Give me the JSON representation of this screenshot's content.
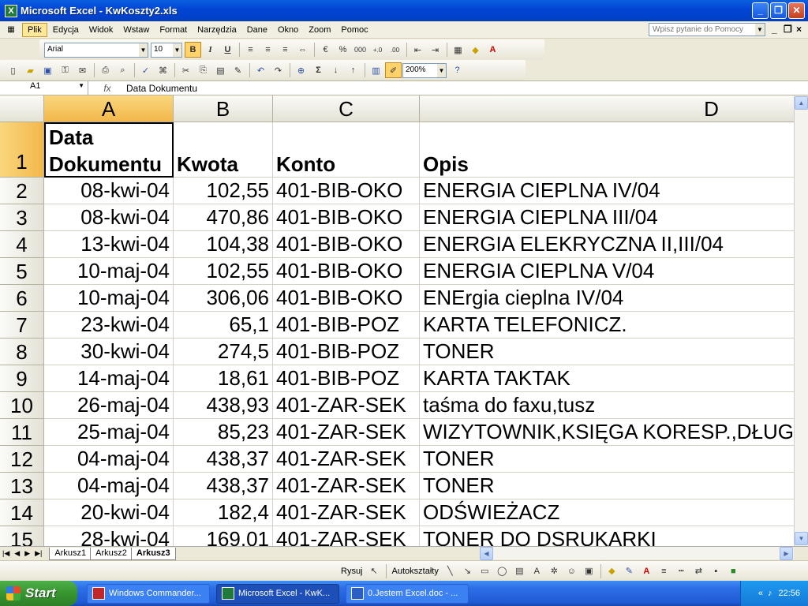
{
  "window": {
    "title": "Microsoft Excel - KwKoszty2.xls",
    "minimize": "_",
    "maximize": "❐",
    "close": "✕"
  },
  "menu": {
    "items": [
      "Plik",
      "Edycja",
      "Widok",
      "Wstaw",
      "Format",
      "Narzędzia",
      "Dane",
      "Okno",
      "Zoom",
      "Pomoc"
    ],
    "help_placeholder": "Wpisz pytanie do Pomocy"
  },
  "format_toolbar": {
    "font": "Arial",
    "size": "10",
    "bold": "B",
    "italic": "I",
    "underline": "U",
    "percent": "%",
    "thousands": "000"
  },
  "standard_toolbar": {
    "zoom": "200%",
    "sigma": "Σ"
  },
  "formula_bar": {
    "cell_ref": "A1",
    "fx": "fx",
    "content": "Data Dokumentu"
  },
  "columns": [
    "A",
    "B",
    "C",
    "D"
  ],
  "header_row": {
    "num": "1",
    "a_line1": "Data",
    "a_line2": "Dokumentu",
    "b": "Kwota",
    "c": "Konto",
    "d": "Opis"
  },
  "rows": [
    {
      "num": "2",
      "date": "08-kwi-04",
      "amount": "102,55",
      "account": "401-BIB-OKO",
      "desc": "ENERGIA CIEPLNA IV/04"
    },
    {
      "num": "3",
      "date": "08-kwi-04",
      "amount": "470,86",
      "account": "401-BIB-OKO",
      "desc": "ENERGIA CIEPLNA III/04"
    },
    {
      "num": "4",
      "date": "13-kwi-04",
      "amount": "104,38",
      "account": "401-BIB-OKO",
      "desc": "ENERGIA ELEKRYCZNA II,III/04"
    },
    {
      "num": "5",
      "date": "10-maj-04",
      "amount": "102,55",
      "account": "401-BIB-OKO",
      "desc": "ENERGIA CIEPLNA V/04"
    },
    {
      "num": "6",
      "date": "10-maj-04",
      "amount": "306,06",
      "account": "401-BIB-OKO",
      "desc": "ENErgia cieplna IV/04"
    },
    {
      "num": "7",
      "date": "23-kwi-04",
      "amount": "65,1",
      "account": "401-BIB-POZ",
      "desc": "KARTA TELEFONICZ."
    },
    {
      "num": "8",
      "date": "30-kwi-04",
      "amount": "274,5",
      "account": "401-BIB-POZ",
      "desc": "TONER"
    },
    {
      "num": "9",
      "date": "14-maj-04",
      "amount": "18,61",
      "account": "401-BIB-POZ",
      "desc": "KARTA TAKTAK"
    },
    {
      "num": "10",
      "date": "26-maj-04",
      "amount": "438,93",
      "account": "401-ZAR-SEK",
      "desc": "taśma do faxu,tusz"
    },
    {
      "num": "11",
      "date": "25-maj-04",
      "amount": "85,23",
      "account": "401-ZAR-SEK",
      "desc": "WIZYTOWNIK,KSIĘGA KORESP.,DŁUGOPISY"
    },
    {
      "num": "12",
      "date": "04-maj-04",
      "amount": "438,37",
      "account": "401-ZAR-SEK",
      "desc": "TONER"
    },
    {
      "num": "13",
      "date": "04-maj-04",
      "amount": "438,37",
      "account": "401-ZAR-SEK",
      "desc": "TONER"
    },
    {
      "num": "14",
      "date": "20-kwi-04",
      "amount": "182,4",
      "account": "401-ZAR-SEK",
      "desc": "ODŚWIEŻACZ"
    },
    {
      "num": "15",
      "date": "28-kwi-04",
      "amount": "169,01",
      "account": "401-ZAR-SEK",
      "desc": "TONER DO DSRUKARKI"
    }
  ],
  "sheet_tabs": [
    "Arkusz1",
    "Arkusz2",
    "Arkusz3"
  ],
  "draw_toolbar": {
    "draw": "Rysuj",
    "autoshapes": "Autokształty"
  },
  "taskbar": {
    "start": "Start",
    "tasks": [
      "Windows Commander...",
      "Microsoft Excel - KwK...",
      "0.Jestem Excel.doc - ..."
    ],
    "clock": "22:56"
  }
}
